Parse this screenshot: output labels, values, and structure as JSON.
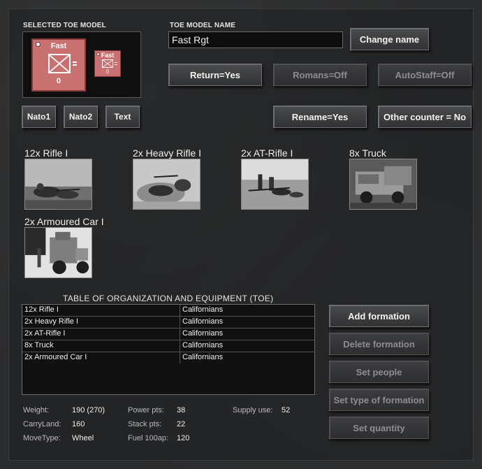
{
  "selected_model": {
    "label": "SELECTED TOE MODEL",
    "counter_title": "Fast",
    "counter_value": "0",
    "small_counter_title": "Fast",
    "small_counter_value": "0",
    "counter_color": "#c97070"
  },
  "model_name": {
    "label": "TOE MODEL NAME",
    "value": "Fast Rgt",
    "change_button": "Change name"
  },
  "toggles": {
    "return": "Return=Yes",
    "romans": "Romans=Off",
    "autostaff": "AutoStaff=Off",
    "rename": "Rename=Yes",
    "other_counter": "Other counter = No"
  },
  "symbol_buttons": {
    "nato1": "Nato1",
    "nato2": "Nato2",
    "text": "Text"
  },
  "units": [
    {
      "label": "12x Rifle I",
      "photo": "rifle-infantry-photo"
    },
    {
      "label": "2x Heavy Rifle I",
      "photo": "heavy-rifle-photo"
    },
    {
      "label": "2x AT-Rifle I",
      "photo": "at-rifle-photo"
    },
    {
      "label": "8x Truck",
      "photo": "truck-photo"
    },
    {
      "label": "2x Armoured Car I",
      "photo": "armoured-car-photo"
    }
  ],
  "toe": {
    "title": "TABLE OF ORGANIZATION AND EQUIPMENT (TOE)",
    "rows": [
      {
        "unit": "12x Rifle I",
        "owner": "Californians"
      },
      {
        "unit": "2x Heavy Rifle I",
        "owner": "Californians"
      },
      {
        "unit": "2x AT-Rifle I",
        "owner": "Californians"
      },
      {
        "unit": "8x Truck",
        "owner": "Californians"
      },
      {
        "unit": "2x Armoured Car I",
        "owner": "Californians"
      }
    ]
  },
  "actions": {
    "add_formation": "Add formation",
    "delete_formation": "Delete formation",
    "set_people": "Set people",
    "set_type": "Set type of formation",
    "set_quantity": "Set quantity"
  },
  "stats": {
    "weight_label": "Weight:",
    "weight": "190 (270)",
    "carry_label": "CarryLand:",
    "carry": "160",
    "move_label": "MoveType:",
    "move": "Wheel",
    "power_label": "Power pts:",
    "power": "38",
    "stack_label": "Stack pts:",
    "stack": "22",
    "fuel_label": "Fuel 100ap:",
    "fuel": "120",
    "supply_label": "Supply use:",
    "supply": "52"
  }
}
